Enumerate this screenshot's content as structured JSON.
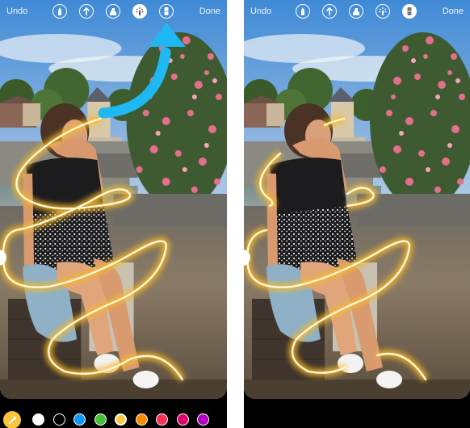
{
  "panels": [
    {
      "id": "before",
      "toolbar": {
        "undo_label": "Undo",
        "done_label": "Done",
        "tools": [
          {
            "name": "pen",
            "icon": "pen-icon",
            "selected": false
          },
          {
            "name": "arrow",
            "icon": "arrow-up-icon",
            "selected": false
          },
          {
            "name": "marker",
            "icon": "marker-icon",
            "selected": false
          },
          {
            "name": "neon",
            "icon": "neon-sparkle-icon",
            "selected": true
          },
          {
            "name": "eraser",
            "icon": "eraser-icon",
            "selected": false
          }
        ]
      },
      "annotation": {
        "type": "curved-arrow",
        "points_to": "eraser tool",
        "color": "#1fb8f2"
      },
      "palette": {
        "eyedropper_color": "#f9c33c",
        "colors": [
          "#ffffff",
          "#000000",
          "#0d99ff",
          "#46c03c",
          "#fdc640",
          "#fc8a00",
          "#fb3158",
          "#e2006c",
          "#b300c2"
        ],
        "selected_color": "#fdc640"
      },
      "neon_line": {
        "color": "#fff6d8",
        "glow": "#f7b928",
        "erased_over_subject": false
      }
    },
    {
      "id": "after",
      "toolbar": {
        "undo_label": "Undo",
        "done_label": "Done",
        "tools": [
          {
            "name": "pen",
            "icon": "pen-icon",
            "selected": false
          },
          {
            "name": "arrow",
            "icon": "arrow-up-icon",
            "selected": false
          },
          {
            "name": "marker",
            "icon": "marker-icon",
            "selected": false
          },
          {
            "name": "neon",
            "icon": "neon-sparkle-icon",
            "selected": false
          },
          {
            "name": "eraser",
            "icon": "eraser-icon",
            "selected": true
          }
        ]
      },
      "neon_line": {
        "color": "#fff6d8",
        "glow": "#f7b928",
        "erased_over_subject": true
      }
    }
  ]
}
